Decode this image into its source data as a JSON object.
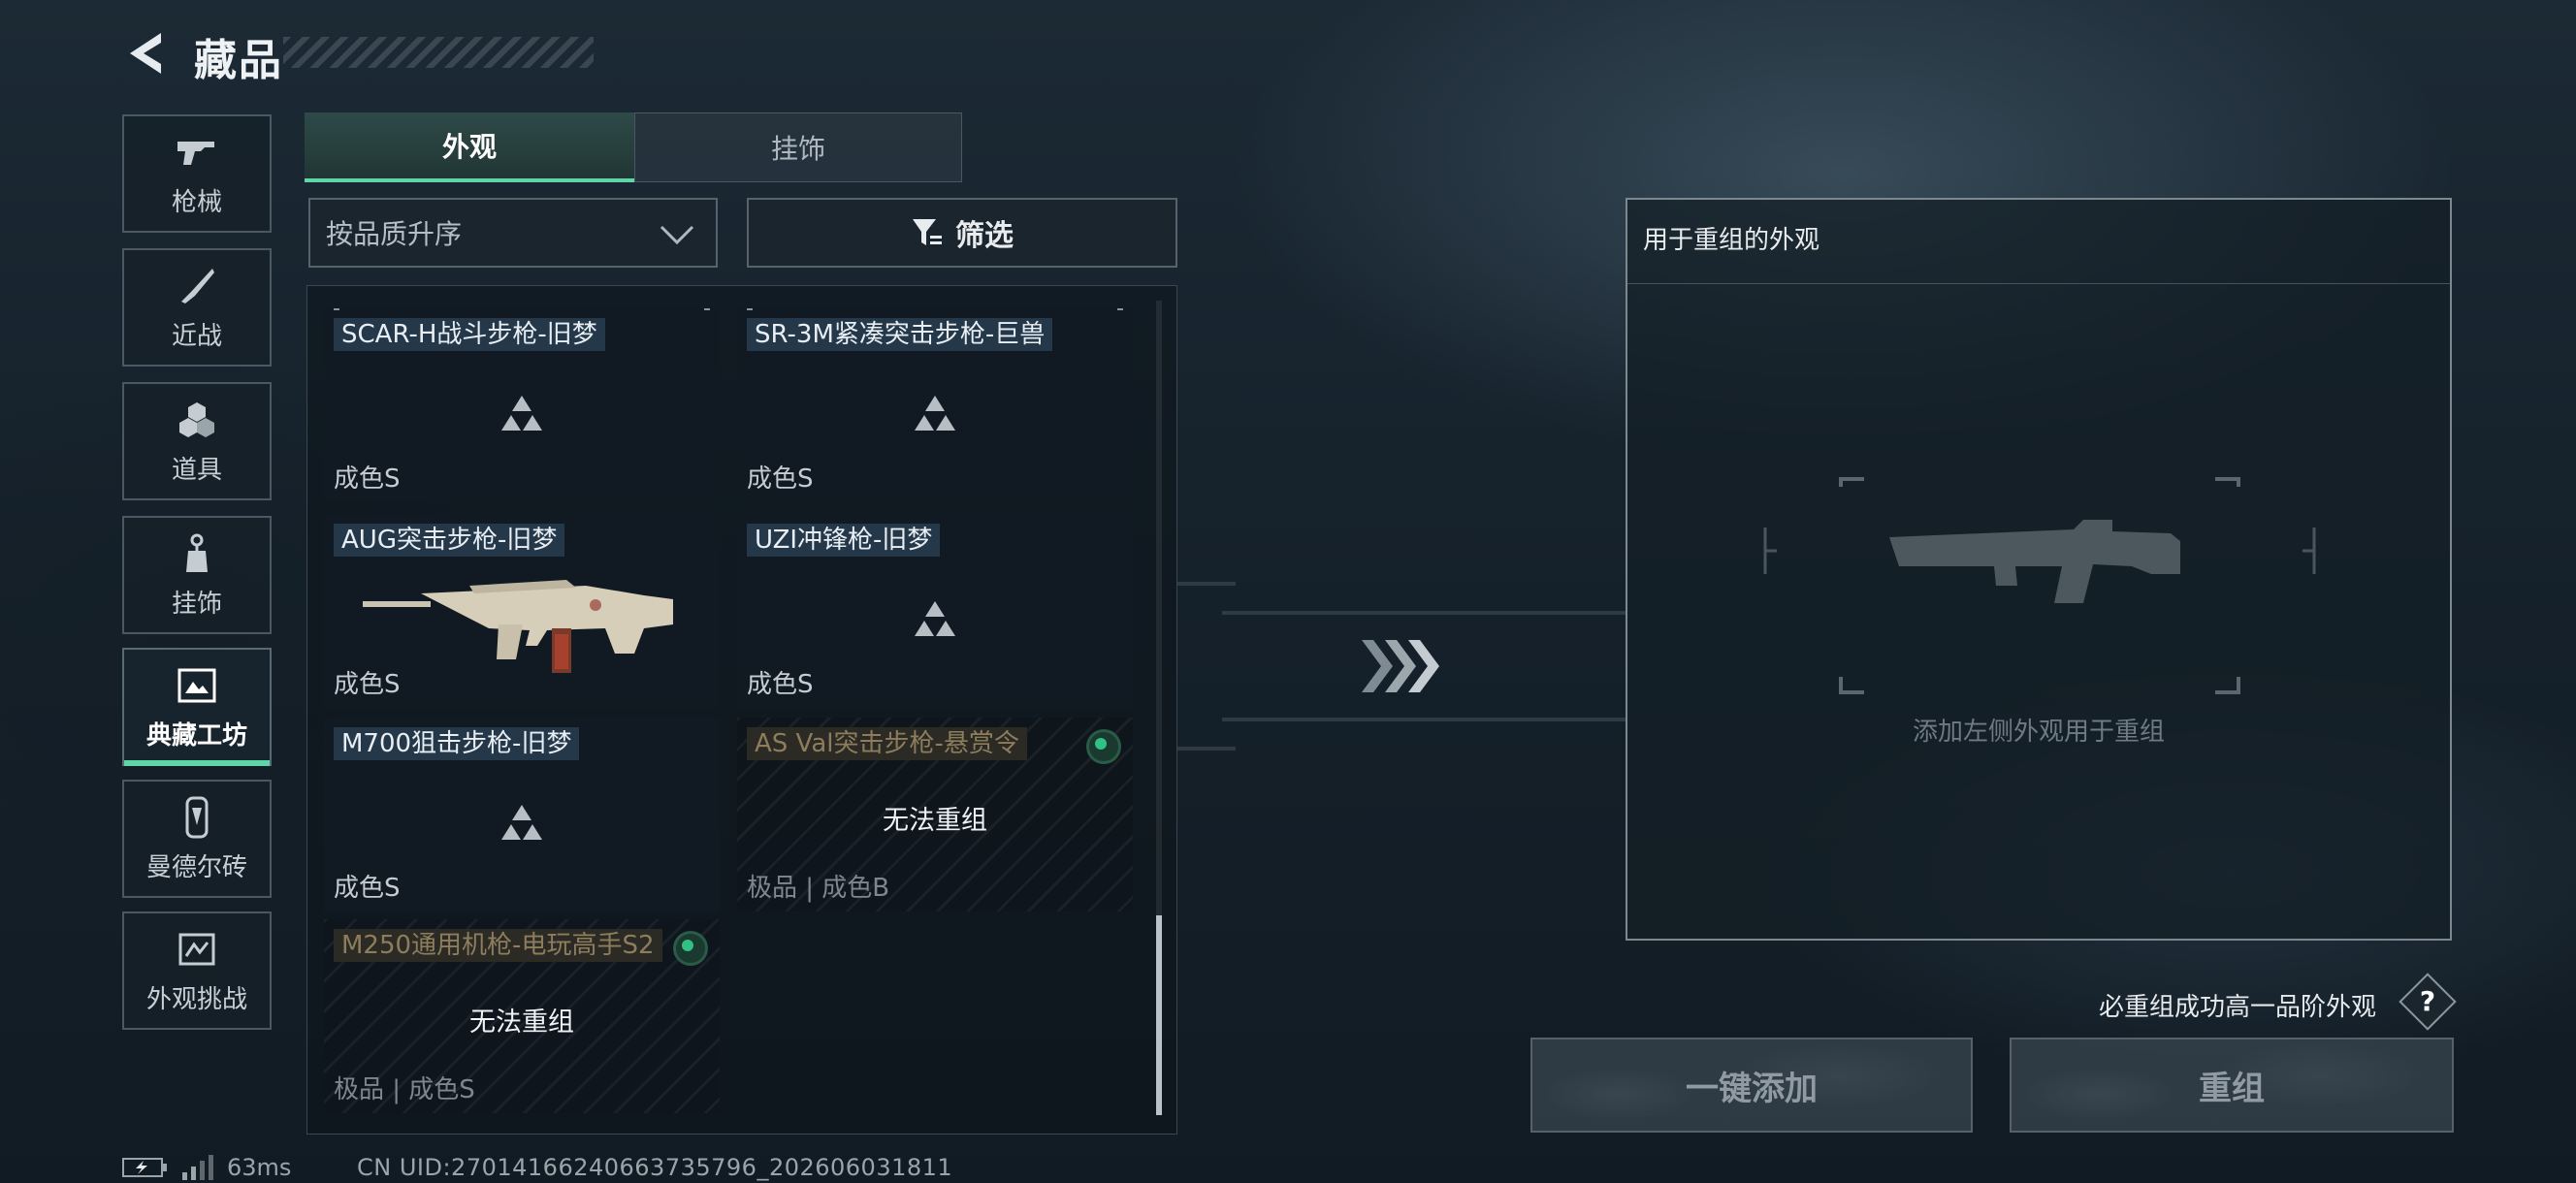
{
  "header": {
    "title": "藏品"
  },
  "sidebar": {
    "items": [
      {
        "label": "枪械",
        "icon": "gun-icon"
      },
      {
        "label": "近战",
        "icon": "knife-icon"
      },
      {
        "label": "道具",
        "icon": "items-icon"
      },
      {
        "label": "挂饰",
        "icon": "charm-icon"
      },
      {
        "label": "典藏工坊",
        "icon": "workshop-icon",
        "active": true
      },
      {
        "label": "曼德尔砖",
        "icon": "brick-icon"
      },
      {
        "label": "外观挑战",
        "icon": "challenge-icon"
      }
    ]
  },
  "tabs": [
    {
      "label": "外观",
      "active": true
    },
    {
      "label": "挂饰",
      "active": false
    }
  ],
  "sort": {
    "value": "按品质升序"
  },
  "filter": {
    "label": "筛选"
  },
  "cards": [
    {
      "name": "SCAR-H战斗步枪-旧梦",
      "grade": "成色S",
      "locked": false
    },
    {
      "name": "SR-3M紧凑突击步枪-巨兽",
      "grade": "成色S",
      "locked": false
    },
    {
      "name": "AUG突击步枪-旧梦",
      "grade": "成色S",
      "locked": false,
      "image": "aug-rifle"
    },
    {
      "name": "UZI冲锋枪-旧梦",
      "grade": "成色S",
      "locked": false
    },
    {
      "name": "M700狙击步枪-旧梦",
      "grade": "成色S",
      "locked": false
    },
    {
      "name": "AS Val突击步枪-悬赏令",
      "grade": "极品 | 成色B",
      "locked": true,
      "lock_text": "无法重组"
    },
    {
      "name": "M250通用机枪-电玩高手S2",
      "grade": "极品 | 成色S",
      "locked": true,
      "lock_text": "无法重组"
    }
  ],
  "recombine": {
    "panel_title": "用于重组的外观",
    "hint": "添加左侧外观用于重组",
    "note": "必重组成功高一品阶外观",
    "help": "?",
    "add_all_label": "一键添加",
    "recombine_label": "重组"
  },
  "footer": {
    "ping": "63ms",
    "uid": "CN UID:270141662406637357​96_202606031811"
  },
  "colors": {
    "accent": "#5fd5a8",
    "status_dot": "#31c184",
    "tag_bg": "#24384a"
  }
}
